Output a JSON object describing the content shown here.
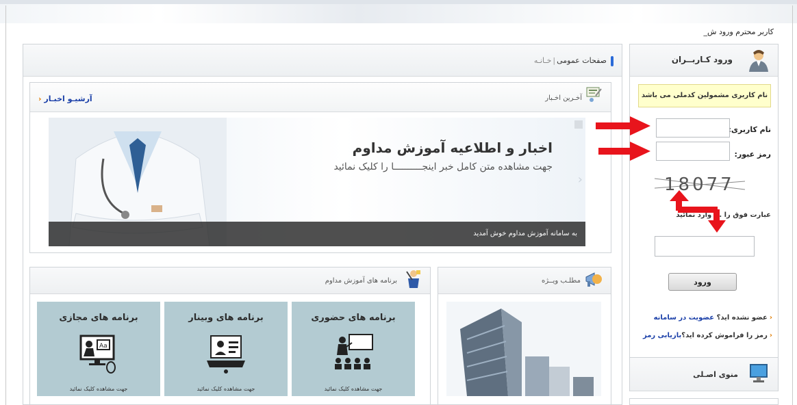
{
  "greeting": "کاربر محترم ورود ش_",
  "main": {
    "breadcrumb": {
      "section": "صفحات عمومی",
      "separator": "|",
      "current": "خـانـه"
    }
  },
  "news": {
    "title": "آخـرین اخـبار",
    "archive_link": "آرشیـو اخبـار",
    "slide": {
      "headline": "اخبار و اطلاعیه آموزش مداوم",
      "subtitle": "جهت مشاهده متن کامل خبر اینجــــــــــا را کلیک نمائید",
      "caption": "به سامانه آموزش مداوم خوش آمدید"
    }
  },
  "special": {
    "title": "مطلـب ویــژه"
  },
  "programs": {
    "title": "برنامه های آموزش مداوم",
    "tiles": [
      {
        "title": "برنامه های حضوری",
        "caption": "جهت مشاهده کلیک نمائید"
      },
      {
        "title": "برنامه های وبینار",
        "caption": "جهت مشاهده کلیک نمائید"
      },
      {
        "title": "برنامه های مجازی",
        "caption": "جهت مشاهده کلیک نمائید"
      }
    ]
  },
  "login": {
    "title": "ورود کـاربــران",
    "notice": "نام کاربری مشمولین کدملی می باشد",
    "username_label": "نام کاربری:",
    "password_label": "رمز عبور:",
    "captcha_text": "18077",
    "captcha_hint": "عبارت فوق را ... وارد نمائید",
    "submit": "ورود",
    "register_text": "عضو نشده اید؟",
    "register_link": "عضویت در سامانه",
    "forgot_text": "رمز را فراموش کرده اید؟",
    "forgot_link": "بازیابی رمز"
  },
  "menu": {
    "title": "منوی اصـلی"
  },
  "colors": {
    "annotation_arrow": "#e8141c",
    "link": "#1a3fa8",
    "accent_arrow": "#e07b00",
    "tile": "#b3cbd2"
  }
}
